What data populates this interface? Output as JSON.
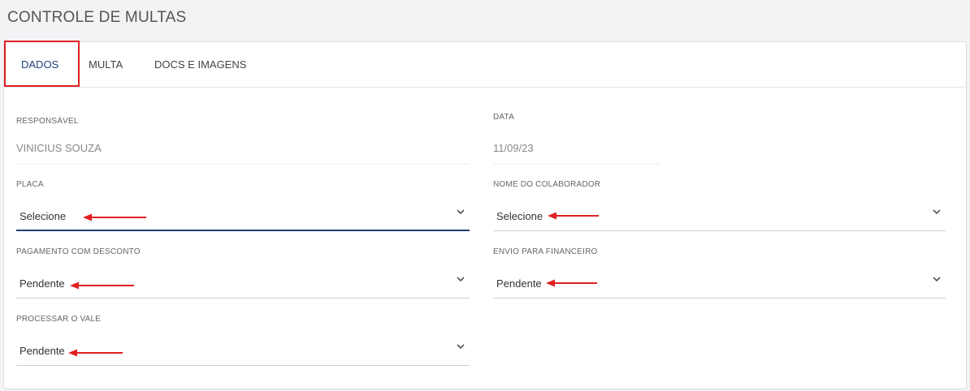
{
  "page": {
    "title": "CONTROLE DE MULTAS"
  },
  "tabs": [
    {
      "label": "DADOS",
      "active": true
    },
    {
      "label": "MULTA",
      "active": false
    },
    {
      "label": "DOCS E IMAGENS",
      "active": false
    }
  ],
  "form": {
    "responsavel": {
      "label": "RESPONSÁVEL",
      "value": "VINICIUS SOUZA"
    },
    "data": {
      "label": "DATA",
      "value": "11/09/23"
    },
    "placa": {
      "label": "PLACA",
      "value": "Selecione"
    },
    "colaborador": {
      "label": "NOME DO COLABORADOR",
      "value": "Selecione"
    },
    "pagamento": {
      "label": "PAGAMENTO COM DESCONTO",
      "value": "Pendente"
    },
    "financeiro": {
      "label": "ENVIO PARA FINANCEIRO",
      "value": "Pendente"
    },
    "vale": {
      "label": "PROCESSAR O VALE",
      "value": "Pendente"
    }
  },
  "colors": {
    "accent": "#1f3f7a",
    "annotation": "#e02020"
  },
  "icons": {
    "select_toggle": "chevron-down-icon",
    "annotation": "red-arrow-icon"
  }
}
